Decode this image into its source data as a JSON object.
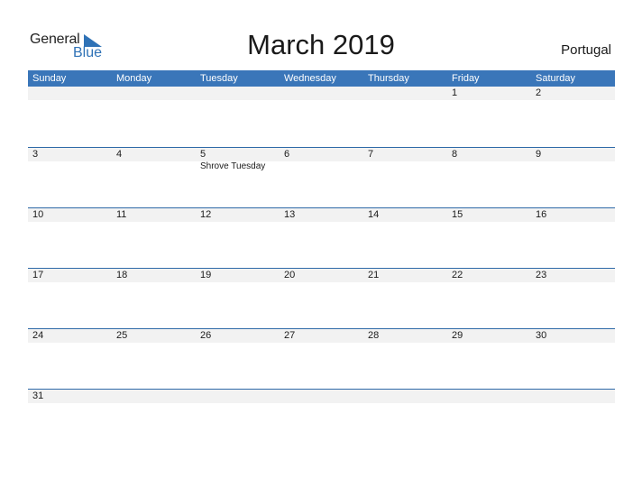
{
  "logo": {
    "word1": "General",
    "word2": "Blue",
    "accent": "#2f72b6"
  },
  "header": {
    "title": "March 2019",
    "country": "Portugal"
  },
  "colors": {
    "header_bg": "#3a76b9",
    "header_text": "#ffffff",
    "band": "#f2f2f2",
    "rule": "#2f6aa8"
  },
  "weekdays": [
    "Sunday",
    "Monday",
    "Tuesday",
    "Wednesday",
    "Thursday",
    "Friday",
    "Saturday"
  ],
  "weeks": [
    [
      "",
      "",
      "",
      "",
      "",
      "1",
      "2"
    ],
    [
      "3",
      "4",
      "5",
      "6",
      "7",
      "8",
      "9"
    ],
    [
      "10",
      "11",
      "12",
      "13",
      "14",
      "15",
      "16"
    ],
    [
      "17",
      "18",
      "19",
      "20",
      "21",
      "22",
      "23"
    ],
    [
      "24",
      "25",
      "26",
      "27",
      "28",
      "29",
      "30"
    ],
    [
      "31",
      "",
      "",
      "",
      "",
      "",
      ""
    ]
  ],
  "events": [
    {
      "week": 1,
      "day": 2,
      "label": "Shrove Tuesday"
    }
  ]
}
